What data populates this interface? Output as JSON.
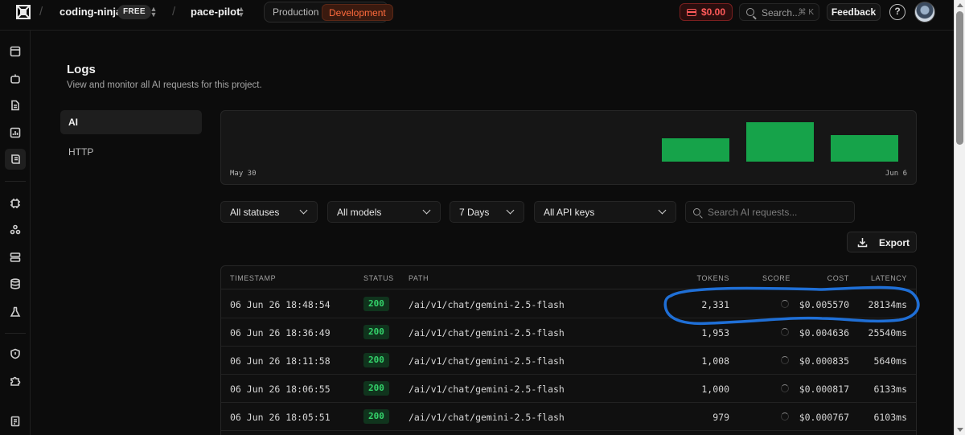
{
  "header": {
    "org_name": "coding-ninja",
    "plan_badge": "FREE",
    "project_name": "pace-pilot",
    "env_production": "Production",
    "env_development": "Development",
    "credit_balance": "$0.00",
    "search_placeholder": "Search...",
    "search_shortcut": "⌘ K",
    "feedback_label": "Feedback",
    "help_label": "?",
    "accent_color": "#ff6b3d",
    "credit_color": "#ff5a5a"
  },
  "page": {
    "title": "Logs",
    "subtitle": "View and monitor all AI requests for this project."
  },
  "subnav": {
    "items": [
      {
        "label": "AI",
        "active": true
      },
      {
        "label": "HTTP",
        "active": false
      }
    ]
  },
  "histogram": {
    "start_label": "May 30",
    "end_label": "Jun 6",
    "bar_color": "#16a34a",
    "bars": [
      {
        "relative_height": 0.6
      },
      {
        "relative_height": 1.0
      },
      {
        "relative_height": 0.67
      }
    ]
  },
  "filters": {
    "status": "All statuses",
    "model": "All models",
    "range": "7 Days",
    "api_keys": "All API keys",
    "search_placeholder": "Search AI requests..."
  },
  "export_label": "Export",
  "table": {
    "columns": {
      "timestamp": "TIMESTAMP",
      "status": "STATUS",
      "path": "PATH",
      "tokens": "TOKENS",
      "score": "SCORE",
      "cost": "COST",
      "latency": "LATENCY"
    },
    "rows": [
      {
        "timestamp": "06 Jun 26 18:48:54",
        "status": "200",
        "path": "/ai/v1/chat/gemini-2.5-flash",
        "tokens": "2,331",
        "cost": "$0.005570",
        "latency": "28134ms"
      },
      {
        "timestamp": "06 Jun 26 18:36:49",
        "status": "200",
        "path": "/ai/v1/chat/gemini-2.5-flash",
        "tokens": "1,953",
        "cost": "$0.004636",
        "latency": "25540ms"
      },
      {
        "timestamp": "06 Jun 26 18:11:58",
        "status": "200",
        "path": "/ai/v1/chat/gemini-2.5-flash",
        "tokens": "1,008",
        "cost": "$0.000835",
        "latency": "5640ms"
      },
      {
        "timestamp": "06 Jun 26 18:06:55",
        "status": "200",
        "path": "/ai/v1/chat/gemini-2.5-flash",
        "tokens": "1,000",
        "cost": "$0.000817",
        "latency": "6133ms"
      },
      {
        "timestamp": "06 Jun 26 18:05:51",
        "status": "200",
        "path": "/ai/v1/chat/gemini-2.5-flash",
        "tokens": "979",
        "cost": "$0.000767",
        "latency": "6103ms"
      }
    ]
  },
  "annotation_color": "#1f6fd6"
}
